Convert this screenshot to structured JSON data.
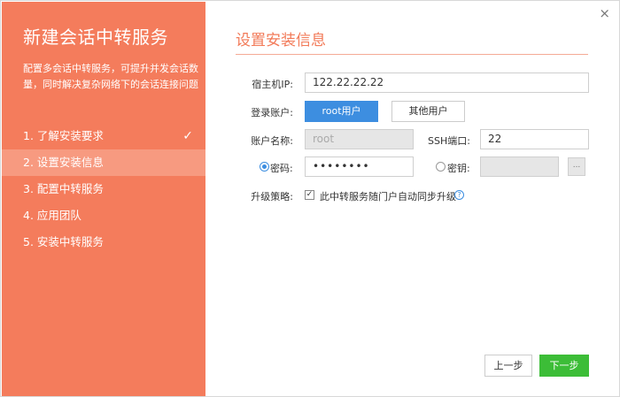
{
  "sidebar": {
    "title": "新建会话中转服务",
    "description": "配置多会话中转服务，可提升并发会话数量，同时解决复杂网络下的会话连接问题",
    "steps": [
      {
        "label": "1. 了解安装要求",
        "done": true
      },
      {
        "label": "2. 设置安装信息",
        "active": true
      },
      {
        "label": "3. 配置中转服务"
      },
      {
        "label": "4. 应用团队"
      },
      {
        "label": "5. 安装中转服务"
      }
    ],
    "check_glyph": "✓"
  },
  "window": {
    "close_glyph": "×"
  },
  "form": {
    "title": "设置安装信息",
    "host_ip_label": "宿主机IP:",
    "host_ip_value": "122.22.22.22",
    "login_account_label": "登录账户:",
    "root_user_label": "root用户",
    "other_user_label": "其他用户",
    "account_name_label": "账户名称:",
    "account_name_value": "root",
    "ssh_port_label": "SSH端口:",
    "ssh_port_value": "22",
    "password_label": "密码:",
    "password_value": "••••••••",
    "key_label": "密钥:",
    "key_value": "",
    "browse_label": "...",
    "upgrade_policy_label": "升级策略:",
    "upgrade_option_label": "此中转服务随门户自动同步升级",
    "upgrade_checked": true,
    "help_glyph": "?"
  },
  "footer": {
    "prev_label": "上一步",
    "next_label": "下一步"
  }
}
